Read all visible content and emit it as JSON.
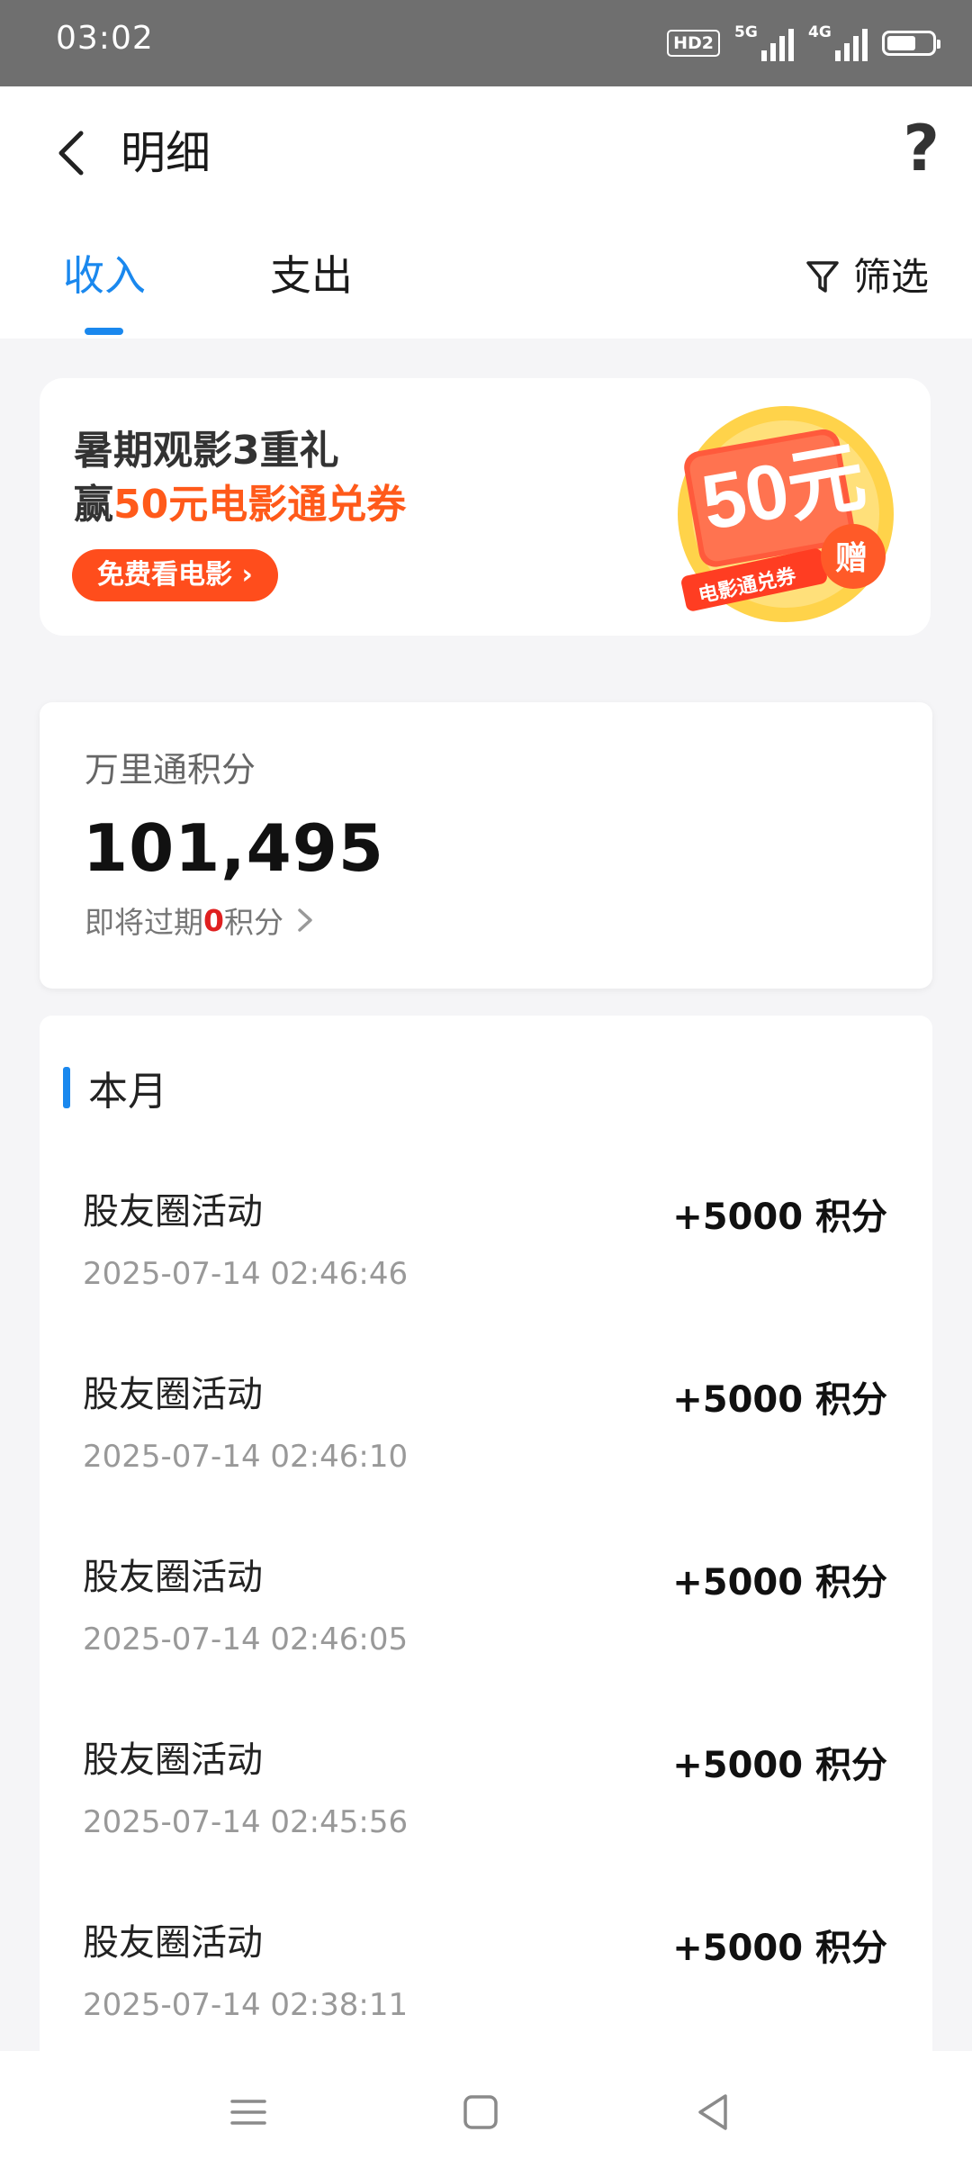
{
  "status_bar": {
    "time": "03:02",
    "hd_label": "HD2",
    "net1_label": "5G",
    "net2_label": "4G",
    "battery_level": 0.65
  },
  "header": {
    "title": "明细",
    "help_label": "?",
    "tabs": [
      {
        "label": "收入",
        "active": true
      },
      {
        "label": "支出",
        "active": false
      }
    ],
    "filter_label": "筛选"
  },
  "banner": {
    "line1": "暑期观影3重礼",
    "line2_prefix": "赢",
    "line2_highlight": "50元电影通兑券",
    "cta_label": "免费看电影",
    "coupon_value": "50元",
    "coupon_caption": "电影通兑券",
    "coupon_badge": "赠"
  },
  "points": {
    "label": "万里通积分",
    "value": "101,495",
    "expire_prefix": "即将过期",
    "expire_count": "0",
    "expire_suffix": "积分"
  },
  "list": {
    "section_title": "本月",
    "items": [
      {
        "name": "股友圈活动",
        "date": "2025-07-14 02:46:46",
        "amount": "+5000 积分"
      },
      {
        "name": "股友圈活动",
        "date": "2025-07-14 02:46:10",
        "amount": "+5000 积分"
      },
      {
        "name": "股友圈活动",
        "date": "2025-07-14 02:46:05",
        "amount": "+5000 积分"
      },
      {
        "name": "股友圈活动",
        "date": "2025-07-14 02:45:56",
        "amount": "+5000 积分"
      },
      {
        "name": "股友圈活动",
        "date": "2025-07-14 02:38:11",
        "amount": "+5000 积分"
      }
    ]
  },
  "colors": {
    "accent": "#1a88ee",
    "promo_orange": "#ff4d1c",
    "expire_red": "#e02020"
  }
}
